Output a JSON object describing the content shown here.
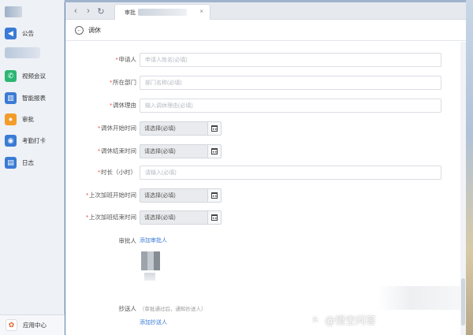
{
  "sidebar": {
    "items": [
      {
        "label": "公告",
        "icon": "megaphone-icon",
        "glyph": "◀",
        "color": "#3a7bd5"
      },
      {
        "label": "视频会议",
        "icon": "phone-icon",
        "glyph": "✆",
        "color": "#2bb673"
      },
      {
        "label": "智能报表",
        "icon": "chart-icon",
        "glyph": "▥",
        "color": "#3a7bd5"
      },
      {
        "label": "审批",
        "icon": "person-icon",
        "glyph": "●",
        "color": "#f39c2a"
      },
      {
        "label": "考勤打卡",
        "icon": "location-icon",
        "glyph": "◉",
        "color": "#3a7bd5"
      },
      {
        "label": "日志",
        "icon": "document-icon",
        "glyph": "▤",
        "color": "#3a7bd5"
      }
    ],
    "app_center": {
      "label": "应用中心",
      "icon": "app-center-icon",
      "glyph": "✿"
    }
  },
  "tabbar": {
    "back_glyph": "‹",
    "forward_glyph": "›",
    "refresh_glyph": "↻",
    "tab_title": "审批",
    "close_glyph": "×"
  },
  "page": {
    "back_glyph": "←",
    "title": "调休"
  },
  "form": {
    "applicant": {
      "label": "申请人",
      "required": true,
      "placeholder": "申请人姓名(必填)"
    },
    "department": {
      "label": "所在部门",
      "required": true,
      "placeholder": "部门名称(必填)"
    },
    "reason": {
      "label": "调休理由",
      "required": true,
      "placeholder": "输入调休理由(必填)"
    },
    "start_time": {
      "label": "调休开始时间",
      "required": true,
      "placeholder": "请选择(必填)"
    },
    "end_time": {
      "label": "调休结束时间",
      "required": true,
      "placeholder": "请选择(必填)"
    },
    "duration": {
      "label": "时长（小时）",
      "required": true,
      "placeholder": "请输入(必填)"
    },
    "last_overtime_start": {
      "label": "上次加班开始时间",
      "required": true,
      "placeholder": "请选择(必填)"
    },
    "last_overtime_end": {
      "label": "上次加班结束时间",
      "required": true,
      "placeholder": "请选择(必填)"
    },
    "approver": {
      "label": "审批人",
      "add_link": "添加审批人"
    },
    "cc": {
      "label": "抄送人",
      "hint": "（审批通过后，通知抄送人）",
      "add_link": "添加抄送人"
    }
  },
  "required_mark": "*",
  "watermark": {
    "badge": "头",
    "text": "@悟空问答"
  }
}
